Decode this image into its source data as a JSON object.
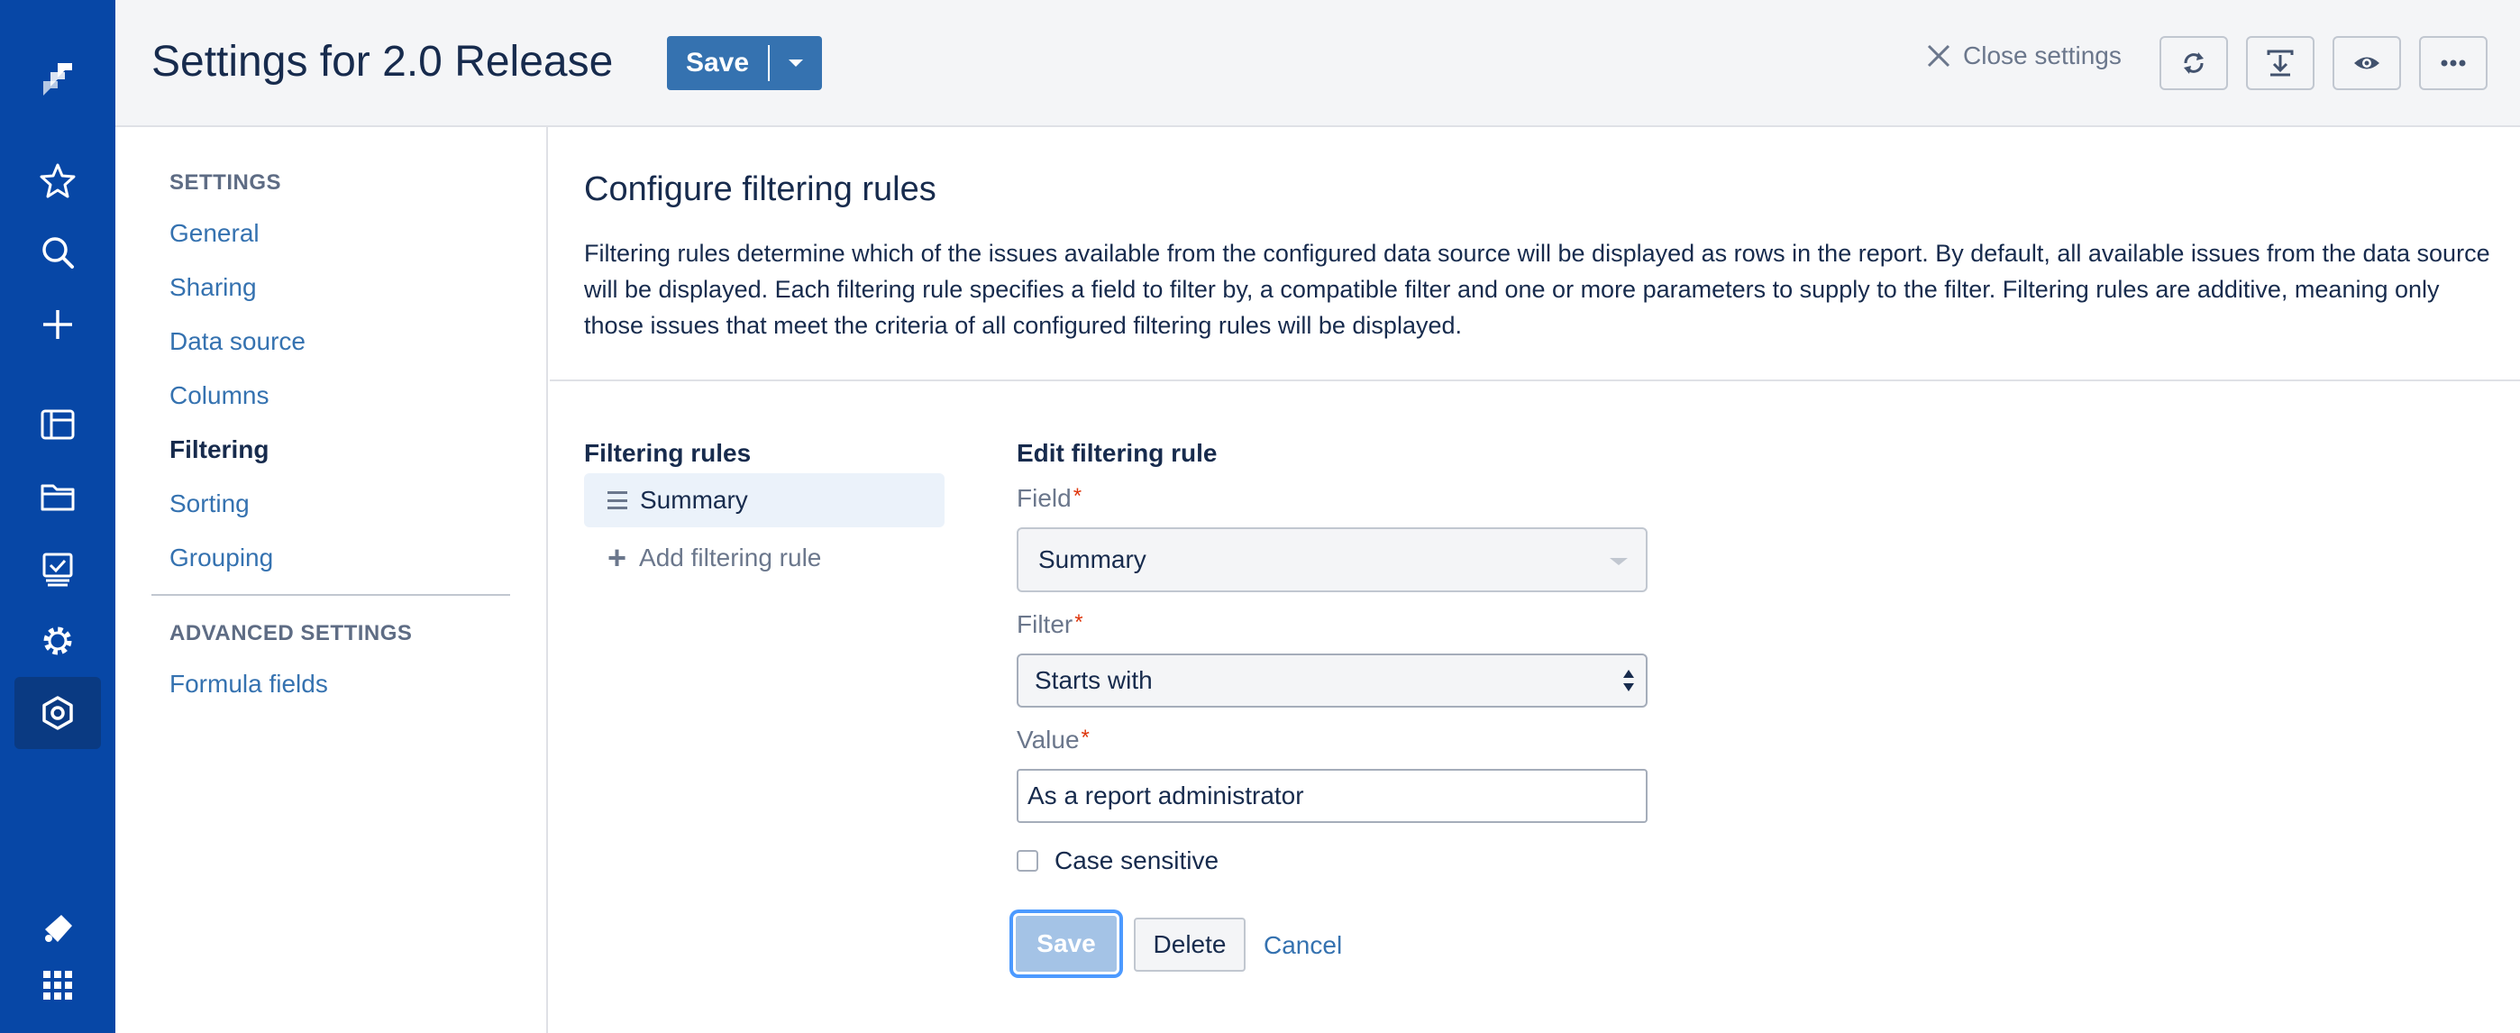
{
  "nav": {
    "icons": [
      "jira-logo-icon",
      "star-icon",
      "search-icon",
      "plus-icon",
      "board-icon",
      "folder-icon",
      "reports-icon",
      "gear-icon",
      "app-settings-icon",
      "feedback-icon",
      "app-switcher-icon"
    ]
  },
  "header": {
    "title": "Settings for 2.0 Release",
    "save_label": "Save",
    "close_label": "Close settings"
  },
  "sidebar": {
    "settings_header": "SETTINGS",
    "items": [
      "General",
      "Sharing",
      "Data source",
      "Columns",
      "Filtering",
      "Sorting",
      "Grouping"
    ],
    "current": "Filtering",
    "advanced_header": "ADVANCED SETTINGS",
    "advanced_items": [
      "Formula fields"
    ]
  },
  "main": {
    "section_title": "Configure filtering rules",
    "description": "Filtering rules determine which of the issues available from the configured data source will be displayed as rows in the report. By default, all available issues from the data source will be displayed. Each filtering rule specifies a field to filter by, a compatible filter and one or more parameters to supply to the filter. Filtering rules are additive, meaning only those issues that meet the criteria of all configured filtering rules will be displayed.",
    "rules_title": "Filtering rules",
    "rules": [
      "Summary"
    ],
    "add_rule_label": "Add filtering rule",
    "edit_title": "Edit filtering rule",
    "field_label": "Field",
    "field_value": "Summary",
    "filter_label": "Filter",
    "filter_value": "Starts with",
    "value_label": "Value",
    "value_value": "As a report administrator",
    "required_mark": "*",
    "case_sensitive_label": "Case sensitive",
    "save_label": "Save",
    "delete_label": "Delete",
    "cancel_label": "Cancel"
  },
  "colors": {
    "nav_bg": "#0747a6",
    "link": "#3572b0",
    "primary": "#3572b0",
    "required": "#de350b"
  }
}
